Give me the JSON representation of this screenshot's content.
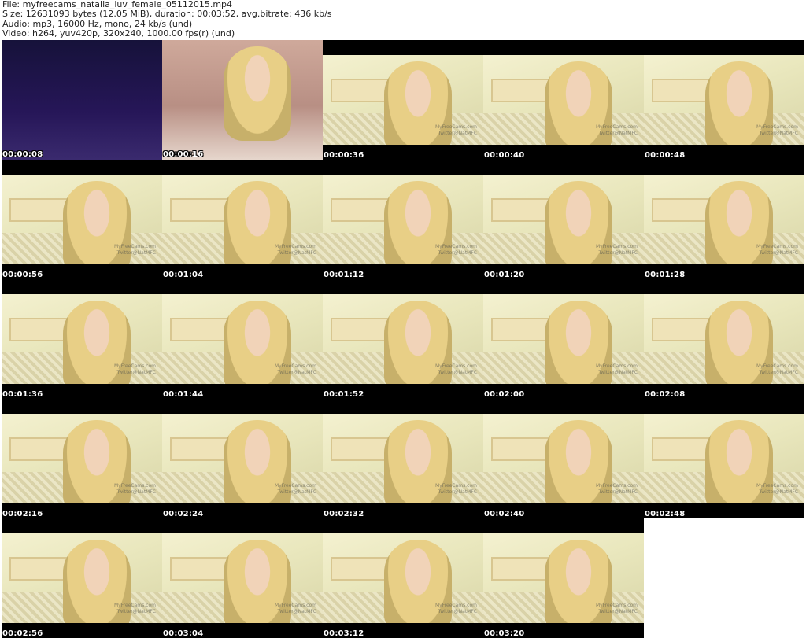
{
  "header": {
    "file": "File: myfreecams_natalia_luv_female_05112015.mp4",
    "size": "Size: 12631093 bytes (12.05 MiB), duration: 00:03:52, avg.bitrate: 436 kb/s",
    "audio": "Audio: mp3, 16000 Hz, mono, 24 kb/s (und)",
    "video": "Video: h264, yuv420p, 320x240, 1000.00 fps(r) (und)"
  },
  "thumbnails": [
    {
      "ts": "00:00:08",
      "kind": "dark"
    },
    {
      "ts": "00:00:16",
      "kind": "room"
    },
    {
      "ts": "00:00:36",
      "kind": "bed"
    },
    {
      "ts": "00:00:40",
      "kind": "bed"
    },
    {
      "ts": "00:00:48",
      "kind": "bed"
    },
    {
      "ts": "00:00:56",
      "kind": "bed"
    },
    {
      "ts": "00:01:04",
      "kind": "bed"
    },
    {
      "ts": "00:01:12",
      "kind": "bed"
    },
    {
      "ts": "00:01:20",
      "kind": "bed"
    },
    {
      "ts": "00:01:28",
      "kind": "bed"
    },
    {
      "ts": "00:01:36",
      "kind": "bed"
    },
    {
      "ts": "00:01:44",
      "kind": "bed"
    },
    {
      "ts": "00:01:52",
      "kind": "bed"
    },
    {
      "ts": "00:02:00",
      "kind": "bed"
    },
    {
      "ts": "00:02:08",
      "kind": "bed"
    },
    {
      "ts": "00:02:16",
      "kind": "bed"
    },
    {
      "ts": "00:02:24",
      "kind": "bed"
    },
    {
      "ts": "00:02:32",
      "kind": "bed"
    },
    {
      "ts": "00:02:40",
      "kind": "bed"
    },
    {
      "ts": "00:02:48",
      "kind": "bed"
    },
    {
      "ts": "00:02:56",
      "kind": "bed"
    },
    {
      "ts": "00:03:04",
      "kind": "bed"
    },
    {
      "ts": "00:03:12",
      "kind": "bed"
    },
    {
      "ts": "00:03:20",
      "kind": "bed"
    }
  ],
  "watermark": {
    "line1": "MyFreeCams.com",
    "line2": "Twitter@NatMFC"
  },
  "colors": {
    "background": "#ffffff",
    "letterbox": "#000000",
    "timestamp": "#ffffff"
  }
}
